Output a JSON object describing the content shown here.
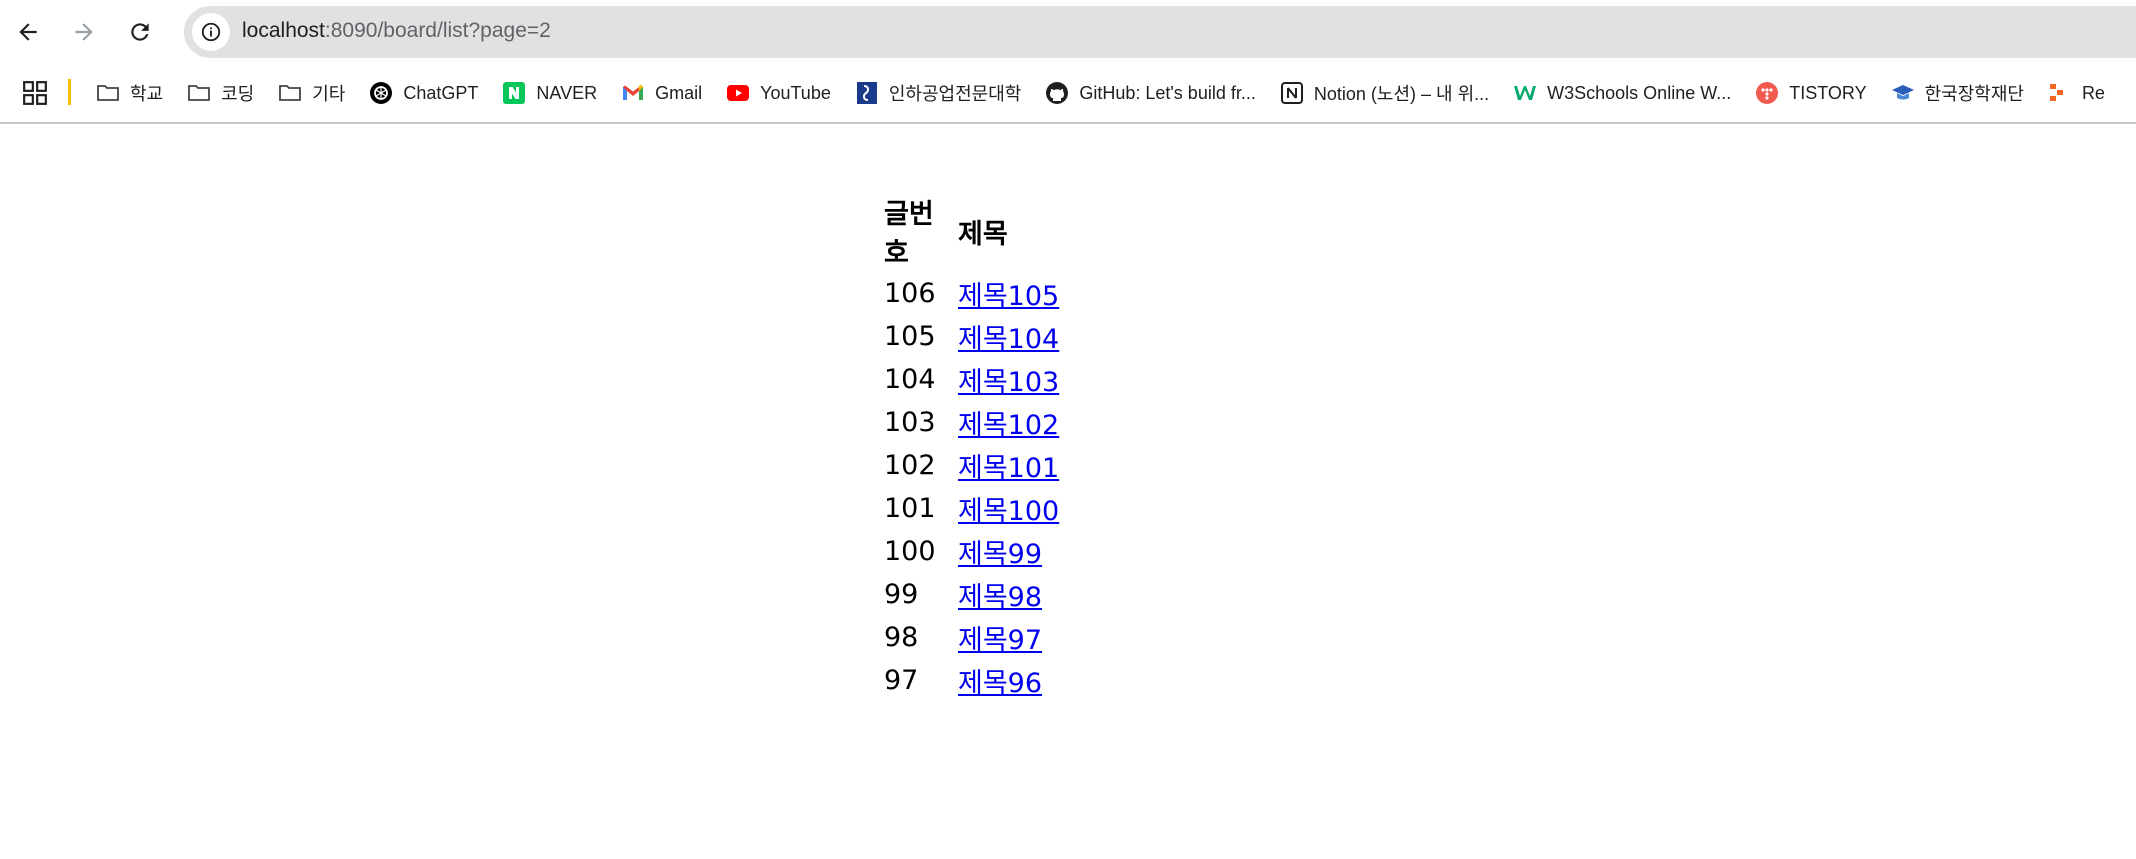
{
  "browser": {
    "url_host": "localhost",
    "url_rest": ":8090/board/list?page=2"
  },
  "bookmarks": [
    {
      "label": "학교",
      "icon": "folder-icon"
    },
    {
      "label": "코딩",
      "icon": "folder-icon"
    },
    {
      "label": "기타",
      "icon": "folder-icon"
    },
    {
      "label": "ChatGPT",
      "icon": "chatgpt-icon"
    },
    {
      "label": "NAVER",
      "icon": "naver-icon"
    },
    {
      "label": "Gmail",
      "icon": "gmail-icon"
    },
    {
      "label": "YouTube",
      "icon": "youtube-icon"
    },
    {
      "label": "인하공업전문대학",
      "icon": "inha-icon"
    },
    {
      "label": "GitHub: Let's build fr...",
      "icon": "github-icon"
    },
    {
      "label": "Notion (노션) – 내 위...",
      "icon": "notion-icon"
    },
    {
      "label": "W3Schools Online W...",
      "icon": "w3schools-icon"
    },
    {
      "label": "TISTORY",
      "icon": "tistory-icon"
    },
    {
      "label": "한국장학재단",
      "icon": "scholarship-icon"
    },
    {
      "label": "Re",
      "icon": "bookmark-icon"
    }
  ],
  "board": {
    "headers": {
      "number": "글번호",
      "title": "제목"
    },
    "rows": [
      {
        "number": "106",
        "title": "제목105"
      },
      {
        "number": "105",
        "title": "제목104"
      },
      {
        "number": "104",
        "title": "제목103"
      },
      {
        "number": "103",
        "title": "제목102"
      },
      {
        "number": "102",
        "title": "제목101"
      },
      {
        "number": "101",
        "title": "제목100"
      },
      {
        "number": "100",
        "title": "제목99"
      },
      {
        "number": "99",
        "title": "제목98"
      },
      {
        "number": "98",
        "title": "제목97"
      },
      {
        "number": "97",
        "title": "제목96"
      }
    ]
  },
  "colors": {
    "link": "#0000ee",
    "folder_divider": "#fbbc04"
  }
}
